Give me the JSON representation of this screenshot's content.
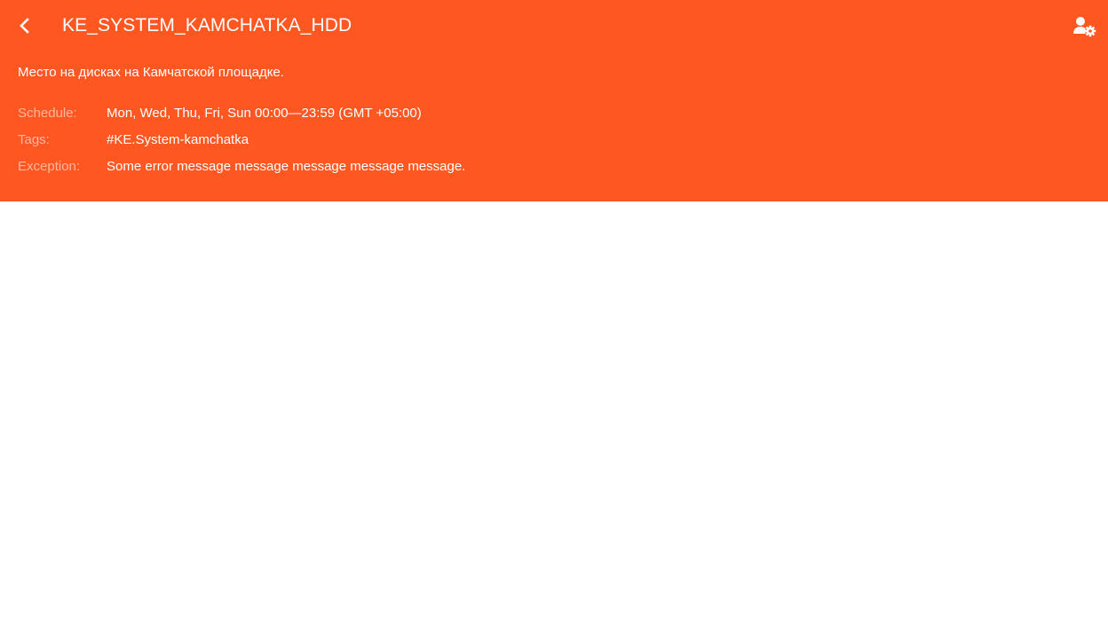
{
  "header": {
    "title": "KE_SYSTEM_KAMCHATKA_HDD",
    "description": "Место на дисках на Камчатской площадке.",
    "back_icon": "chevron-left-icon",
    "settings_icon": "user-settings-icon",
    "background_color": "#ff5722"
  },
  "info": {
    "schedule": {
      "label": "Schedule:",
      "value": "Mon, Wed, Thu, Fri, Sun 00:00—23:59 (GMT +05:00)"
    },
    "tags": {
      "label": "Tags:",
      "value": "#KE.System-kamchatka"
    },
    "exception": {
      "label": "Exception:",
      "value": "Some error message message message message message."
    }
  }
}
